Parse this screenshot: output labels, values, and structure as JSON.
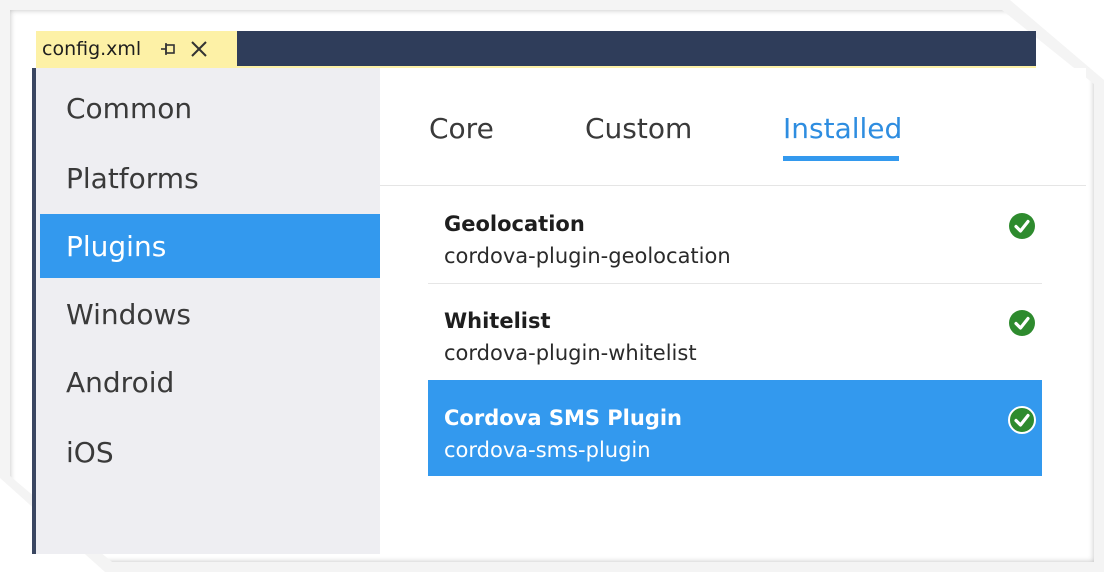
{
  "document_tab": {
    "label": "config.xml",
    "pin_icon": "pin-icon",
    "close_icon": "close-icon"
  },
  "sidebar": {
    "items": [
      {
        "label": "Common",
        "selected": false
      },
      {
        "label": "Platforms",
        "selected": false
      },
      {
        "label": "Plugins",
        "selected": true
      },
      {
        "label": "Windows",
        "selected": false
      },
      {
        "label": "Android",
        "selected": false
      },
      {
        "label": "iOS",
        "selected": false
      }
    ]
  },
  "tabs": [
    {
      "label": "Core",
      "active": false
    },
    {
      "label": "Custom",
      "active": false
    },
    {
      "label": "Installed",
      "active": true
    }
  ],
  "plugins": [
    {
      "name": "Geolocation",
      "id": "cordova-plugin-geolocation",
      "installed": true,
      "selected": false
    },
    {
      "name": "Whitelist",
      "id": "cordova-plugin-whitelist",
      "installed": true,
      "selected": false
    },
    {
      "name": "Cordova SMS Plugin",
      "id": "cordova-sms-plugin",
      "installed": true,
      "selected": true
    }
  ],
  "colors": {
    "titlebar": "#2f3d5a",
    "active_doc_tab": "#fdf1a6",
    "selection": "#3399ee",
    "active_tab_text": "#2e8de0",
    "installed_check": "#2e8b2e"
  }
}
